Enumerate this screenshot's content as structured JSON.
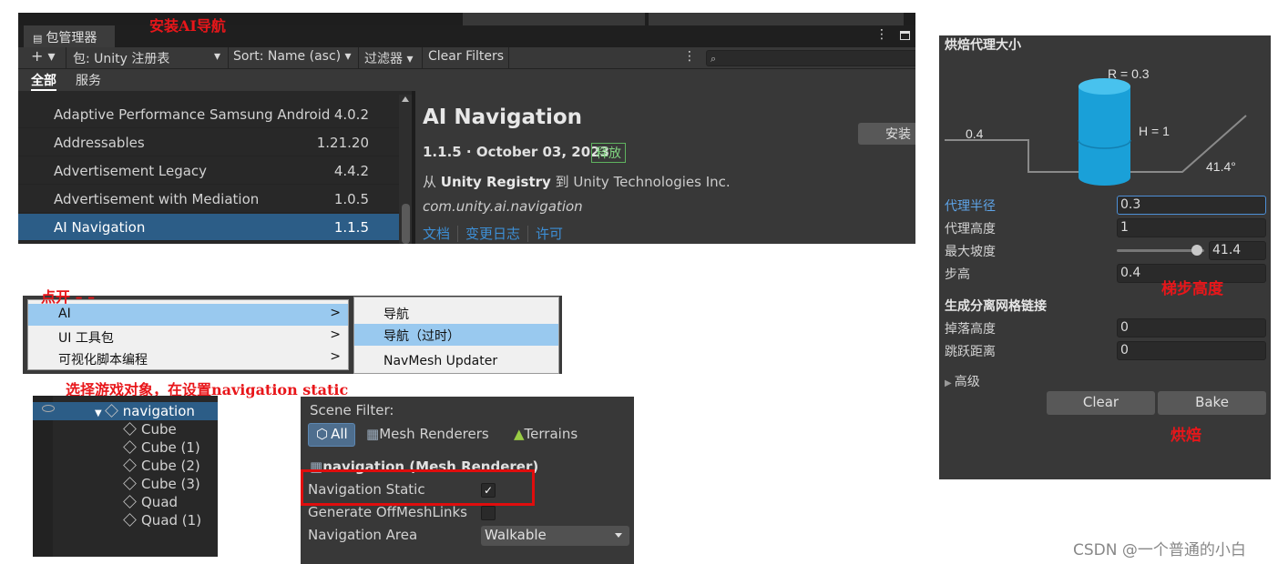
{
  "annotations": {
    "install_nav": "安装AI导航",
    "click_open": "点开  – –",
    "select_obj": "选择游戏对象，在设置navigation static",
    "step_height": "梯步高度",
    "bake": "烘焙"
  },
  "package_manager": {
    "tab_title": "包管理器",
    "tab_menu": "⋮",
    "add": "+ ▾",
    "packages_source": "包: Unity 注册表",
    "sort": "Sort: Name (asc) ▾",
    "filter": "过滤器 ▾",
    "clear_filters": "Clear Filters",
    "more": "⋮",
    "search_icon": "⌕",
    "subtab_all": "全部",
    "subtab_services": "服务",
    "packages": [
      {
        "name": "Adaptive Performance Samsung Android",
        "version": "4.0.2"
      },
      {
        "name": "Addressables",
        "version": "1.21.20"
      },
      {
        "name": "Advertisement Legacy",
        "version": "4.4.2"
      },
      {
        "name": "Advertisement with Mediation",
        "version": "1.0.5"
      },
      {
        "name": "AI Navigation",
        "version": "1.1.5"
      }
    ],
    "detail": {
      "title": "AI Navigation",
      "version_date": "1.1.5 · October 03, 2023",
      "badge": "释放",
      "from_prefix": "从 ",
      "from_registry": "Unity Registry",
      "from_mid": " 到 ",
      "from_company": "Unity Technologies Inc.",
      "package_id": "com.unity.ai.navigation",
      "links": [
        "文档",
        "变更日志",
        "许可"
      ],
      "install_button": "安装"
    }
  },
  "context_menu": {
    "left_items": [
      {
        "label": "AI",
        "arrow": ">",
        "highlighted": true
      },
      {
        "label": "UI 工具包",
        "arrow": ">",
        "highlighted": false
      },
      {
        "label": "可视化脚本编程",
        "arrow": ">",
        "highlighted": false
      }
    ],
    "right_items": [
      {
        "label": "导航",
        "highlighted": false
      },
      {
        "label": "导航（过时）",
        "highlighted": true
      },
      {
        "label": "NavMesh Updater",
        "highlighted": false
      }
    ]
  },
  "hierarchy": {
    "root": "navigation",
    "children": [
      "Cube",
      "Cube (1)",
      "Cube (2)",
      "Cube (3)",
      "Quad",
      "Quad (1)"
    ]
  },
  "scene_filter": {
    "title": "Scene Filter:",
    "all": "All",
    "mesh_renderers": "Mesh Renderers",
    "terrains": "Terrains",
    "section": "navigation (Mesh Renderer)",
    "nav_static_label": "Navigation Static",
    "nav_static_checked": "✓",
    "offmesh_label": "Generate OffMeshLinks",
    "area_label": "Navigation Area",
    "area_value": "Walkable"
  },
  "bake_panel": {
    "agent_size_title": "烘焙代理大小",
    "diagram_r": "R = 0.3",
    "diagram_h": "H = 1",
    "diagram_step": "0.4",
    "diagram_slope": "41.4°",
    "agent_radius_label": "代理半径",
    "agent_radius": "0.3",
    "agent_height_label": "代理高度",
    "agent_height": "1",
    "max_slope_label": "最大坡度",
    "max_slope": "41.4",
    "max_slope_fraction": 0.92,
    "step_height_label": "步高",
    "step_height": "0.4",
    "offmesh_title": "生成分离网格链接",
    "drop_height_label": "掉落高度",
    "drop_height": "0",
    "jump_distance_label": "跳跃距离",
    "jump_distance": "0",
    "advanced": "高级",
    "clear_button": "Clear",
    "bake_button": "Bake"
  },
  "watermark": "CSDN @一个普通的小白",
  "colors": {
    "selection_blue": "#2c5d87",
    "annotation_red": "#e8161a",
    "link_blue": "#3d8fd6",
    "cylinder_blue": "#1aa0d8"
  }
}
